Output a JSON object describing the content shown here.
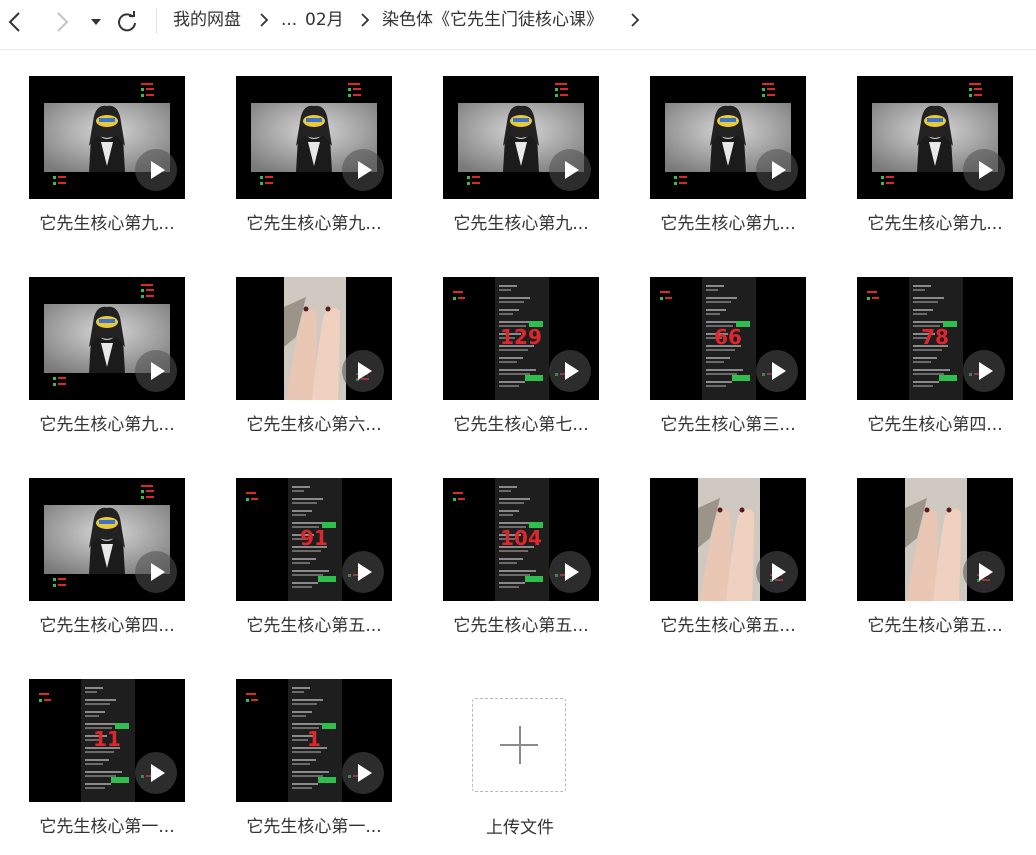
{
  "breadcrumb": {
    "root": "我的网盘",
    "ellipsis": "...",
    "month": "02月",
    "current": "染色体《它先生门徒核心课》"
  },
  "files": [
    {
      "name": "它先生核心第九...",
      "thumb": "portrait"
    },
    {
      "name": "它先生核心第九...",
      "thumb": "portrait"
    },
    {
      "name": "它先生核心第九...",
      "thumb": "portrait"
    },
    {
      "name": "它先生核心第九...",
      "thumb": "portrait"
    },
    {
      "name": "它先生核心第九...",
      "thumb": "portrait"
    },
    {
      "name": "它先生核心第九...",
      "thumb": "portrait"
    },
    {
      "name": "它先生核心第六...",
      "thumb": "feet"
    },
    {
      "name": "它先生核心第七...",
      "thumb": "chat",
      "number": "129"
    },
    {
      "name": "它先生核心第三...",
      "thumb": "chat",
      "number": "66"
    },
    {
      "name": "它先生核心第四...",
      "thumb": "chat",
      "number": "78"
    },
    {
      "name": "它先生核心第四...",
      "thumb": "portrait"
    },
    {
      "name": "它先生核心第五...",
      "thumb": "chat",
      "number": "91"
    },
    {
      "name": "它先生核心第五...",
      "thumb": "chat",
      "number": "104"
    },
    {
      "name": "它先生核心第五...",
      "thumb": "feet"
    },
    {
      "name": "它先生核心第五...",
      "thumb": "feet"
    },
    {
      "name": "它先生核心第一...",
      "thumb": "chat",
      "number": "11"
    },
    {
      "name": "它先生核心第一...",
      "thumb": "chat",
      "number": "1"
    }
  ],
  "upload": {
    "label": "上传文件"
  },
  "colors": {
    "accent_red": "#e0262d",
    "chat_green": "#2fbf4f"
  }
}
